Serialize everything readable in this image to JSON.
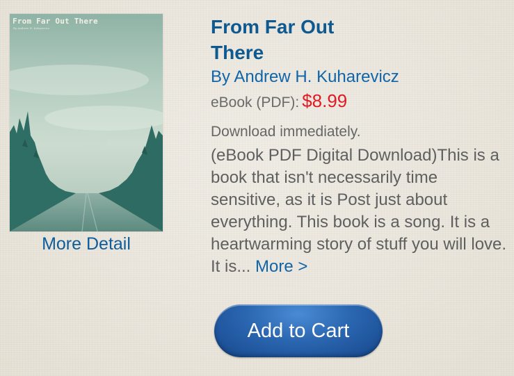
{
  "product": {
    "cover": {
      "title_text": "From Far Out There",
      "author_text": "By Andrew H. Kuharevicz",
      "colors": {
        "sky": "#a6c4b8",
        "trees": "#2f6e65",
        "road": "#6f9a8f"
      },
      "more_detail_label": "More Detail"
    },
    "title": "From Far Out There",
    "author": "By Andrew H. Kuharevicz",
    "format_label": "eBook (PDF):",
    "price": "$8.99",
    "availability": "Download immediately.",
    "description": "(eBook PDF Digital Download)This is a book that isn't necessarily time sensitive, as it is Post just about everything. This book is a song. It is a heartwarming story of stuff you will love. It is...",
    "more_link_label": "More >"
  },
  "actions": {
    "add_to_cart_label": "Add to Cart"
  },
  "colors": {
    "link_blue": "#1065a8",
    "title_blue": "#0e5990",
    "price_red": "#e01b24",
    "button_blue": "#2a66b0",
    "background": "#ece8df"
  }
}
